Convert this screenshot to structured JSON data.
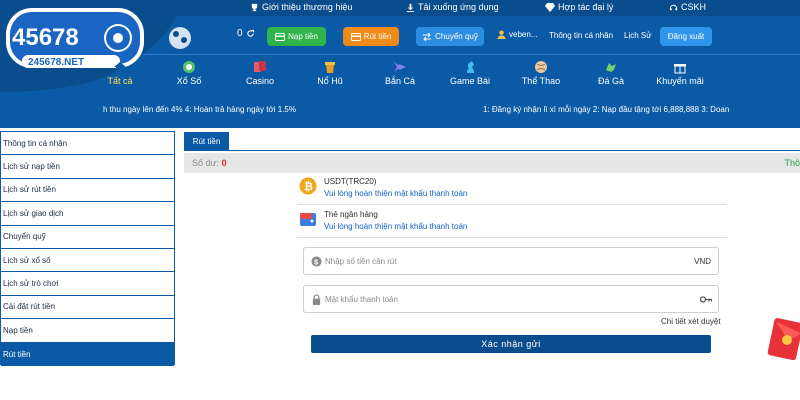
{
  "header": {
    "top_links": [
      {
        "label": "Giới thiệu thương hiệu",
        "icon": "trophy-icon"
      },
      {
        "label": "Tải xuống ứng dụng",
        "icon": "download-icon"
      },
      {
        "label": "Hợp tác đại lý",
        "icon": "diamond-icon"
      },
      {
        "label": "CSKH",
        "icon": "headset-icon"
      }
    ],
    "logo": {
      "number": "45678",
      "domain": "245678.NET"
    },
    "balance": "0",
    "buttons": {
      "deposit": "Nạp tiền",
      "withdraw": "Rút tiền",
      "transfer": "Chuyển quỹ"
    },
    "username": "veben...",
    "links": {
      "profile": "Thông tin cá nhân",
      "history": "Lịch Sử"
    },
    "logout": "Đăng xuất"
  },
  "nav": {
    "items": [
      {
        "label": "Tất cả",
        "icon": "home-icon"
      },
      {
        "label": "Xổ Số",
        "icon": "lottery-ball-icon"
      },
      {
        "label": "Casino",
        "icon": "cards-icon"
      },
      {
        "label": "Nổ Hũ",
        "icon": "slot-jar-icon"
      },
      {
        "label": "Bắn Cá",
        "icon": "fish-icon"
      },
      {
        "label": "Game Bài",
        "icon": "chess-knight-icon"
      },
      {
        "label": "Thể Thao",
        "icon": "ball-icon"
      },
      {
        "label": "Đá Gà",
        "icon": "rooster-icon"
      },
      {
        "label": "Khuyến mãi",
        "icon": "gift-icon"
      }
    ]
  },
  "marquee": {
    "left": "h thu ngày lên đến 4% 4: Hoàn trả hàng ngày tới 1.5%",
    "right": "1: Đăng ký nhận lì xì mỗi ngày 2: Nạp đầu tặng tới 6,888,888 3: Doan"
  },
  "sidebar": {
    "items": [
      {
        "label": "Thông tin cá nhân"
      },
      {
        "label": "Lịch sử nạp tiền"
      },
      {
        "label": "Lịch sử rút tiền"
      },
      {
        "label": "Lịch sử giao dịch"
      },
      {
        "label": "Chuyển quỹ"
      },
      {
        "label": "Lịch sử xổ số"
      },
      {
        "label": "Lịch sử trò chơi"
      },
      {
        "label": "Cài đặt rút tiền"
      },
      {
        "label": "Nạp tiền"
      },
      {
        "label": "Rút tiền"
      }
    ]
  },
  "main": {
    "tab": "Rút tiền",
    "balance_label": "Số dư:",
    "balance_value": "0",
    "right_text": "Thô",
    "methods": [
      {
        "title": "USDT(TRC20)",
        "subtitle": "Vui lòng hoàn thiện mật khẩu thanh toán",
        "icon": "bitcoin-icon"
      },
      {
        "title": "Thẻ ngân hàng",
        "subtitle": "Vui lòng hoàn thiện mật khẩu thanh toán",
        "icon": "wallet-icon"
      }
    ],
    "amount_field": {
      "placeholder": "Nhập số tiền cần rút",
      "suffix": "VND"
    },
    "password_field": {
      "placeholder": "Mật khẩu thanh toán"
    },
    "detail_link": "Chi tiết xét duyệt",
    "submit": "Xác nhận gửi"
  },
  "colors": {
    "primary": "#0a5aa6",
    "dark": "#0a4d8c",
    "green": "#2fb34a",
    "orange": "#f08b18",
    "balance_red": "#e03131"
  }
}
